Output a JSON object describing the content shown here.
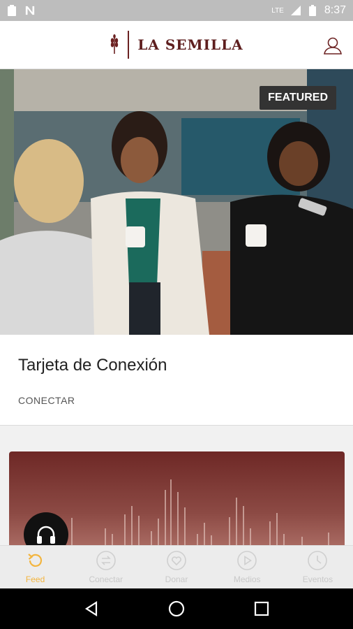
{
  "status_bar": {
    "time": "8:37",
    "network": "LTE"
  },
  "header": {
    "brand": "LA SEMILLA"
  },
  "featured": {
    "badge": "FEATURED",
    "title": "Tarjeta de Conexión",
    "action": "CONECTAR"
  },
  "nav": {
    "items": [
      {
        "label": "Feed",
        "icon": "refresh-icon",
        "active": true
      },
      {
        "label": "Conectar",
        "icon": "sync-icon",
        "active": false
      },
      {
        "label": "Donar",
        "icon": "heart-icon",
        "active": false
      },
      {
        "label": "Medios",
        "icon": "play-icon",
        "active": false
      },
      {
        "label": "Eventos",
        "icon": "clock-icon",
        "active": false
      }
    ]
  },
  "colors": {
    "brand": "#6b2121",
    "accent": "#f3b53f",
    "card_gradient_top": "#6e2826"
  }
}
